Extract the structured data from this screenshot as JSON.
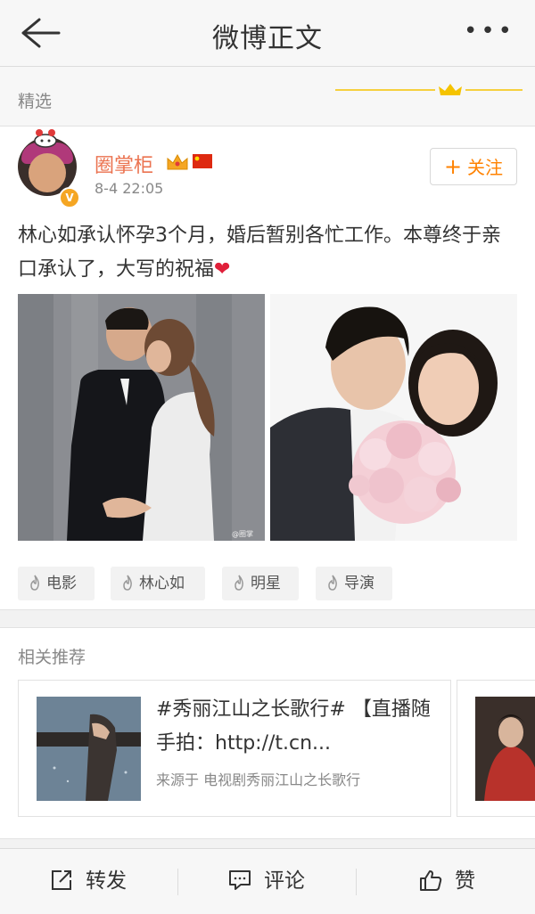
{
  "header": {
    "title": "微博正文"
  },
  "section": {
    "label": "精选"
  },
  "post": {
    "username": "圈掌柜",
    "time": "8-4 22:05",
    "follow_label": "关注",
    "text": "林心如承认怀孕3个月，婚后暂别各忙工作。本尊终于亲口承认了，大写的祝福",
    "heart": "❤",
    "watermark": "@圈掌",
    "tags": [
      "电影",
      "林心如",
      "明星",
      "导演"
    ]
  },
  "related": {
    "label": "相关推荐",
    "card": {
      "title": "#秀丽江山之长歌行# 【直播随手拍：http://t.cn...",
      "source": "来源于 电视剧秀丽江山之长歌行"
    }
  },
  "footer": {
    "repost_label": "转发",
    "comment_label": "评论",
    "like_label": "赞"
  },
  "colors": {
    "accent": "#ff8200",
    "username": "#eb7350",
    "crown": "#f5c300"
  }
}
